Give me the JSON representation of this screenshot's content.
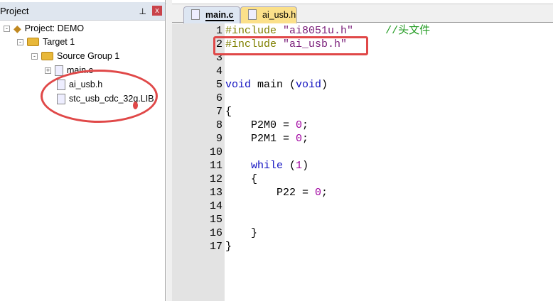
{
  "project_panel": {
    "title": "Project",
    "pin_icon": "⊥",
    "close_icon": "x",
    "tree": [
      {
        "label": "Project: DEMO"
      },
      {
        "label": "Target 1"
      },
      {
        "label": "Source Group 1"
      },
      {
        "label": "main.c"
      },
      {
        "label": "ai_usb.h"
      },
      {
        "label": "stc_usb_cdc_32g.LIB"
      }
    ]
  },
  "tabs": [
    {
      "label": "main.c",
      "active": true
    },
    {
      "label": "ai_usb.h",
      "active": false
    }
  ],
  "editor": {
    "lines": [
      {
        "n": "1",
        "parts": [
          [
            "pp",
            "#include "
          ],
          [
            "str",
            "\"ai8051u.h\""
          ],
          [
            "",
            "     "
          ],
          [
            "cm",
            "//头文件"
          ]
        ]
      },
      {
        "n": "2",
        "parts": [
          [
            "pp",
            "#include "
          ],
          [
            "str",
            "\"ai_usb.h\""
          ]
        ]
      },
      {
        "n": "3",
        "parts": []
      },
      {
        "n": "4",
        "parts": []
      },
      {
        "n": "5",
        "parts": [
          [
            "kw",
            "void"
          ],
          [
            "",
            " main ("
          ],
          [
            "kw",
            "void"
          ],
          [
            "",
            ")"
          ]
        ]
      },
      {
        "n": "6",
        "parts": []
      },
      {
        "n": "7",
        "parts": [
          [
            "",
            "{"
          ]
        ]
      },
      {
        "n": "8",
        "parts": [
          [
            "",
            "    P2M0 = "
          ],
          [
            "n",
            "0"
          ],
          [
            "",
            ";"
          ]
        ]
      },
      {
        "n": "9",
        "parts": [
          [
            "",
            "    P2M1 = "
          ],
          [
            "n",
            "0"
          ],
          [
            "",
            ";"
          ]
        ]
      },
      {
        "n": "10",
        "parts": []
      },
      {
        "n": "11",
        "parts": [
          [
            "",
            "    "
          ],
          [
            "kw",
            "while"
          ],
          [
            "",
            " ("
          ],
          [
            "n",
            "1"
          ],
          [
            "",
            ")"
          ]
        ]
      },
      {
        "n": "12",
        "parts": [
          [
            "",
            "    {"
          ]
        ]
      },
      {
        "n": "13",
        "parts": [
          [
            "",
            "        P22 = "
          ],
          [
            "n",
            "0"
          ],
          [
            "",
            ";"
          ]
        ]
      },
      {
        "n": "14",
        "parts": []
      },
      {
        "n": "15",
        "parts": []
      },
      {
        "n": "16",
        "parts": [
          [
            "",
            "    }"
          ]
        ]
      },
      {
        "n": "17",
        "parts": [
          [
            "",
            "}"
          ]
        ]
      }
    ]
  },
  "colors": {
    "annotation": "#e04848",
    "tab_active": "#dde6f2",
    "tab_inactive": "#fbe08a"
  }
}
